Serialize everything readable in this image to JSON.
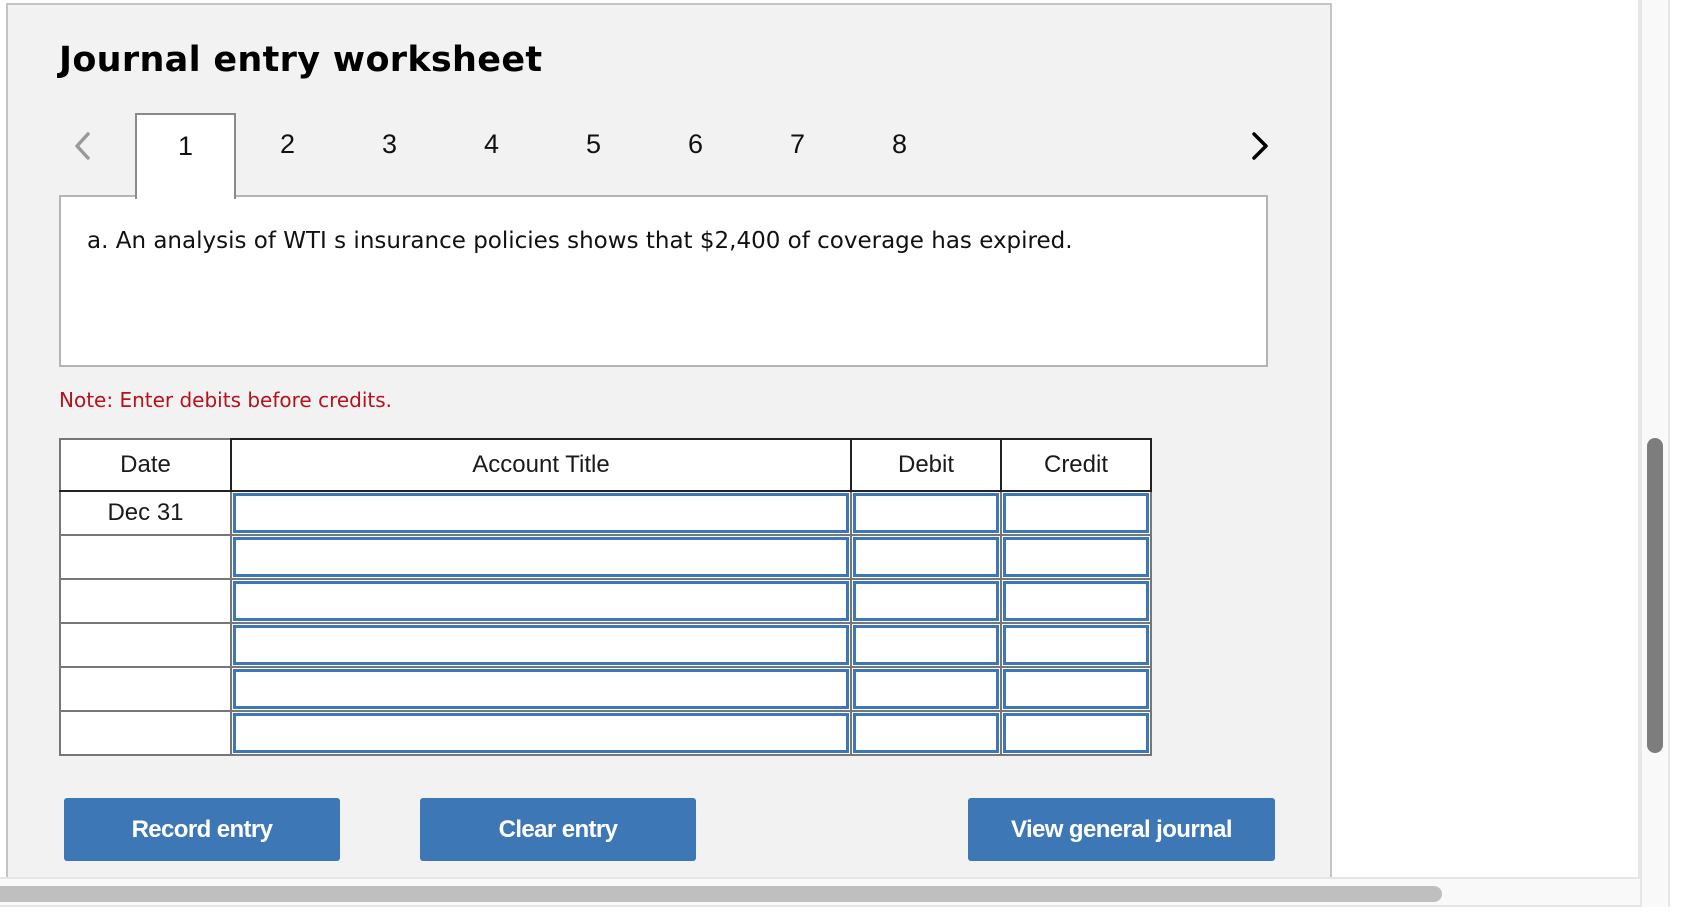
{
  "worksheet": {
    "title": "Journal entry worksheet",
    "tabs": [
      {
        "label": "1",
        "active": true
      },
      {
        "label": "2",
        "active": false
      },
      {
        "label": "3",
        "active": false
      },
      {
        "label": "4",
        "active": false
      },
      {
        "label": "5",
        "active": false
      },
      {
        "label": "6",
        "active": false
      },
      {
        "label": "7",
        "active": false
      },
      {
        "label": "8",
        "active": false
      }
    ],
    "prev_icon": "chevron-left-icon",
    "next_icon": "chevron-right-icon",
    "question": "a. An analysis of WTI   s insurance policies shows that $2,400 of coverage has expired.",
    "note": "Note: Enter debits before credits."
  },
  "journal_table": {
    "headers": {
      "date": "Date",
      "account_title": "Account Title",
      "debit": "Debit",
      "credit": "Credit"
    },
    "rows": [
      {
        "date": "Dec 31",
        "account_title": "",
        "debit": "",
        "credit": ""
      },
      {
        "date": "",
        "account_title": "",
        "debit": "",
        "credit": ""
      },
      {
        "date": "",
        "account_title": "",
        "debit": "",
        "credit": ""
      },
      {
        "date": "",
        "account_title": "",
        "debit": "",
        "credit": ""
      },
      {
        "date": "",
        "account_title": "",
        "debit": "",
        "credit": ""
      },
      {
        "date": "",
        "account_title": "",
        "debit": "",
        "credit": ""
      }
    ]
  },
  "buttons": {
    "record": "Record entry",
    "clear": "Clear entry",
    "view_journal": "View general journal"
  },
  "colors": {
    "accent": "#3d77b6",
    "note": "#b5121b",
    "panel_bg": "#f2f2f2"
  }
}
